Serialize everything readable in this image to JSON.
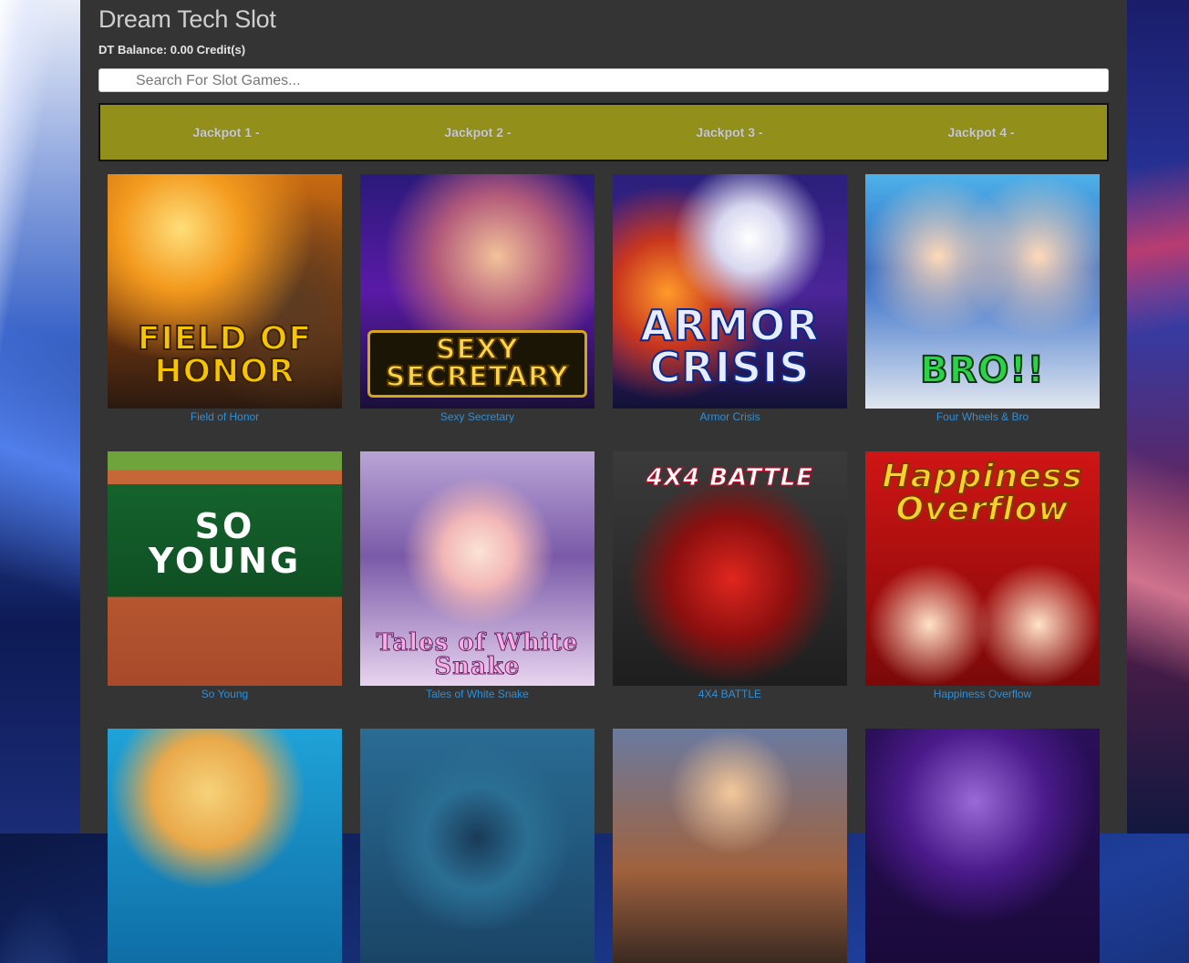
{
  "header": {
    "title": "Dream Tech Slot",
    "balance": "DT Balance: 0.00 Credit(s)"
  },
  "search": {
    "placeholder": "Search For Slot Games..."
  },
  "jackpots": [
    {
      "label": "Jackpot 1 -"
    },
    {
      "label": "Jackpot 2 -"
    },
    {
      "label": "Jackpot 3 -"
    },
    {
      "label": "Jackpot 4 -"
    }
  ],
  "games": [
    {
      "name": "Field of Honor",
      "art_text": "FIELD OF HONOR"
    },
    {
      "name": "Sexy Secretary",
      "art_text": "SEXY SECRETARY"
    },
    {
      "name": "Armor Crisis",
      "art_text": "ARMOR CRISIS"
    },
    {
      "name": "Four Wheels & Bro",
      "art_text": "BRO!!"
    },
    {
      "name": "So Young",
      "art_text": "SO YOUNG"
    },
    {
      "name": "Tales of White Snake",
      "art_text": "Tales of White Snake"
    },
    {
      "name": "4X4 BATTLE",
      "art_text": "4X4 BATTLE"
    },
    {
      "name": "Happiness Overflow",
      "art_text": "Happiness Overflow"
    },
    {
      "name": "",
      "art_text": ""
    },
    {
      "name": "",
      "art_text": ""
    },
    {
      "name": "",
      "art_text": ""
    },
    {
      "name": "",
      "art_text": ""
    }
  ],
  "colors": {
    "panel": "#343434",
    "jackpot_bar": "#92901a",
    "link": "#2f8fd8"
  }
}
